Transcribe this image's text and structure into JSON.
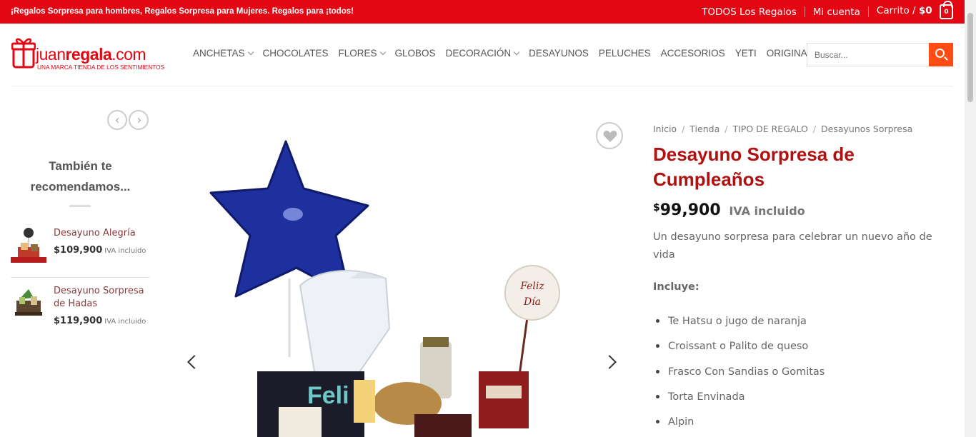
{
  "topbar": {
    "promo": "¡Regalos Sorpresa para hombres, Regalos Sorpresa para Mujeres. Regalos para ¡todos!",
    "links": [
      "TODOS Los Regalos",
      "Mi cuenta"
    ],
    "cart_label": "Carrito /",
    "cart_total": "$0",
    "cart_count": "0",
    "color": "#e30613"
  },
  "logo": {
    "brand_prefix": "juan",
    "brand_bold": "regala",
    "brand_suffix": ".com",
    "tagline": "UNA MARCA TIENDA DE LOS SENTIMIENTOS"
  },
  "nav": {
    "items": [
      {
        "label": "ANCHETAS",
        "dropdown": true
      },
      {
        "label": "CHOCOLATES",
        "dropdown": false
      },
      {
        "label": "FLORES",
        "dropdown": true
      },
      {
        "label": "GLOBOS",
        "dropdown": false
      },
      {
        "label": "DECORACIÓN",
        "dropdown": true
      },
      {
        "label": "DESAYUNOS",
        "dropdown": false
      },
      {
        "label": "PELUCHES",
        "dropdown": false
      },
      {
        "label": "ACCESORIOS",
        "dropdown": false
      },
      {
        "label": "YETI",
        "dropdown": false
      },
      {
        "label": "ORIGINAL",
        "dropdown": true
      }
    ]
  },
  "search": {
    "placeholder": "Buscar...",
    "button_color": "#ff4c15",
    "icon": "search-icon"
  },
  "sidebar": {
    "title": "También te recomendamos...",
    "products": [
      {
        "name": "Desayuno Alegría",
        "price": "$109,900",
        "tax": "IVA incluido"
      },
      {
        "name": "Desayuno Sorpresa de Hadas",
        "price": "$119,900",
        "tax": "IVA incluido"
      }
    ]
  },
  "gallery": {
    "topper_text_line1": "Feliz",
    "topper_text_line2": "Día",
    "mug_text": "Feli"
  },
  "product": {
    "breadcrumb": [
      "Inicio",
      "Tienda",
      "TIPO DE REGALO",
      "Desayunos Sorpresa"
    ],
    "title": "Desayuno Sorpresa de Cumpleaños",
    "currency": "$",
    "price": "99,900",
    "tax": "IVA incluido",
    "description": "Un desayuno sorpresa para celebrar un nuevo año de vida",
    "includes_label": "Incluye:",
    "includes": [
      "Te Hatsu o jugo de naranja",
      "Croissant o Palito de queso",
      "Frasco Con Sandias o Gomitas",
      "Torta Envinada",
      "Alpin"
    ]
  }
}
